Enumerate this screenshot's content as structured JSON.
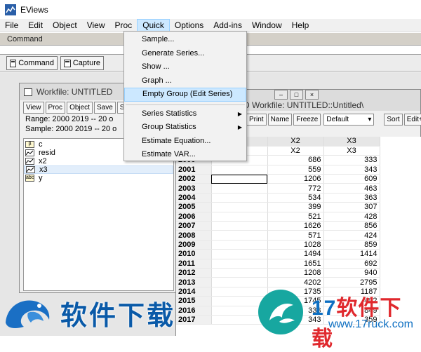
{
  "app": {
    "title": "EViews"
  },
  "menu": [
    "File",
    "Edit",
    "Object",
    "View",
    "Proc",
    "Quick",
    "Options",
    "Add-ins",
    "Window",
    "Help"
  ],
  "command": {
    "title": "Command",
    "tabs": [
      "Command",
      "Capture"
    ]
  },
  "quick_menu": {
    "items": [
      "Sample...",
      "Generate Series...",
      "Show ...",
      "Graph ...",
      "Empty Group (Edit Series)"
    ],
    "items2": [
      "Series Statistics",
      "Group Statistics",
      "Estimate Equation...",
      "Estimate VAR..."
    ],
    "highlighted": "Empty Group (Edit Series)"
  },
  "workfile": {
    "title": "Workfile: UNTITLED",
    "toolbar": [
      "View",
      "Proc",
      "Object",
      "Save",
      "Sna"
    ],
    "range_line": "Range:  2000 2019   --  20 o",
    "sample_line": "Sample: 2000 2019   --  20 o",
    "objects": [
      {
        "icon": "β",
        "name": "c"
      },
      {
        "icon": "",
        "name": "resid"
      },
      {
        "icon": "",
        "name": "x2"
      },
      {
        "icon": "",
        "name": "x3"
      },
      {
        "icon": "abc",
        "name": "y"
      }
    ],
    "selected": "x3"
  },
  "group_window": {
    "title_partial": "ED   Workfile: UNTITLED::Untitled\\",
    "toolbar": [
      "Print",
      "Name",
      "Freeze"
    ],
    "dropdown_value": "Default",
    "toolbar2": [
      "Sort",
      "Edit+/-"
    ],
    "columns": [
      "X2",
      "X3"
    ],
    "rows": [
      [
        "2000",
        "686",
        "333"
      ],
      [
        "2001",
        "559",
        "343"
      ],
      [
        "2002",
        "1206",
        "609"
      ],
      [
        "2003",
        "772",
        "463"
      ],
      [
        "2004",
        "534",
        "363"
      ],
      [
        "2005",
        "399",
        "307"
      ],
      [
        "2006",
        "521",
        "428"
      ],
      [
        "2007",
        "1626",
        "856"
      ],
      [
        "2008",
        "571",
        "424"
      ],
      [
        "2009",
        "1028",
        "859"
      ],
      [
        "2010",
        "1494",
        "1414"
      ],
      [
        "2011",
        "1651",
        "692"
      ],
      [
        "2012",
        "1208",
        "940"
      ],
      [
        "2013",
        "4202",
        "2795"
      ],
      [
        "2014",
        "1735",
        "1187"
      ],
      [
        "2015",
        "1745",
        "402"
      ],
      [
        "2016",
        "333",
        "849"
      ],
      [
        "2017",
        "343",
        "359"
      ]
    ]
  },
  "watermark": {
    "left_text": "软件下载",
    "right_num": "17",
    "right_text": "软件下载",
    "url": "www.17ruck.com"
  },
  "colors": {
    "highlight": "#cce8ff",
    "watermark_blue": "#0a5aa8",
    "watermark_red": "#e0282d"
  }
}
